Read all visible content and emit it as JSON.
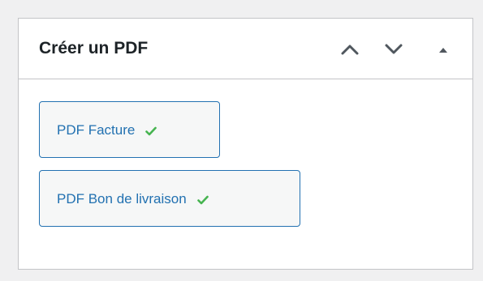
{
  "metabox": {
    "title": "Créer un PDF",
    "controls": {
      "move_up_icon": "chevron-up-icon",
      "move_down_icon": "chevron-down-icon",
      "toggle_icon": "triangle-up-icon"
    },
    "buttons": [
      {
        "label": "PDF Facture",
        "status_icon": "checkmark-icon"
      },
      {
        "label": "PDF Bon de livraison",
        "status_icon": "checkmark-icon"
      }
    ]
  },
  "colors": {
    "background": "#f0f0f1",
    "panel": "#ffffff",
    "border": "#c3c4c7",
    "title_text": "#1d2327",
    "button_text": "#2271b1",
    "button_border": "#2271b1",
    "button_bg": "#f6f7f7",
    "check": "#46b450",
    "control_icon": "#50575e"
  }
}
